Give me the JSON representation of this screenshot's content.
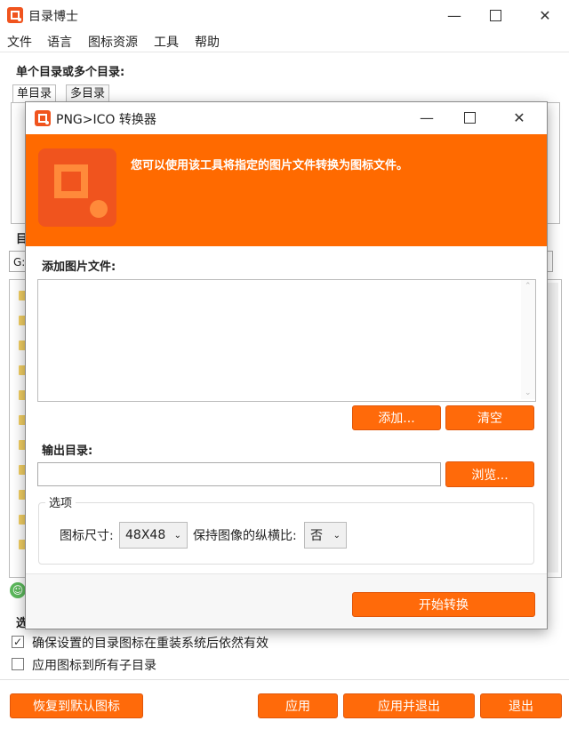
{
  "main": {
    "title": "目录博士",
    "menu": [
      "文件",
      "语言",
      "图标资源",
      "工具",
      "帮助"
    ],
    "dir_section_label": "单个目录或多个目录:",
    "tabs": [
      "单目录",
      "多目录"
    ],
    "side_label_1": "目",
    "path_value": "G:\\",
    "options_label": "选",
    "checkbox1": {
      "label": "确保设置的目录图标在重装系统后依然有效",
      "checked": true
    },
    "checkbox2": {
      "label": "应用图标到所有子目录",
      "checked": false
    },
    "buttons": {
      "restore": "恢复到默认图标",
      "apply": "应用",
      "apply_exit": "应用并退出",
      "exit": "退出"
    },
    "status_icon": "smiley-icon"
  },
  "dialog": {
    "title": "PNG>ICO 转换器",
    "banner_text": "您可以使用该工具将指定的图片文件转换为图标文件。",
    "add_files_label": "添加图片文件:",
    "add_button": "添加...",
    "clear_button": "清空",
    "output_dir_label": "输出目录:",
    "output_dir_value": "",
    "browse_button": "浏览...",
    "options_legend": "选项",
    "icon_size_label": "图标尺寸:",
    "icon_size_value": "48X48",
    "keep_ratio_label": "保持图像的纵横比:",
    "keep_ratio_value": "否",
    "start_button": "开始转换"
  },
  "colors": {
    "accent": "#ff6a00",
    "button": "#ff6a0a",
    "folder": "#f2cf63"
  }
}
